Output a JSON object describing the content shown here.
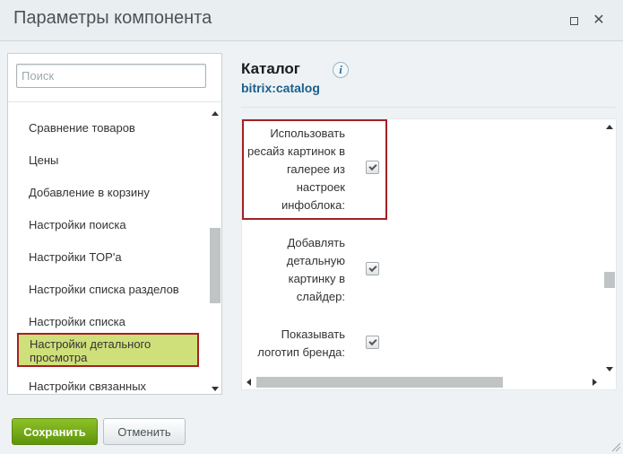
{
  "window": {
    "title": "Параметры компонента",
    "maximize_icon": "maximize-icon",
    "close_icon": "close-icon",
    "close_glyph": "✕"
  },
  "search": {
    "placeholder": "Поиск",
    "value": ""
  },
  "sidebar": {
    "items": [
      {
        "label": "Сравнение товаров",
        "active": false
      },
      {
        "label": "Цены",
        "active": false
      },
      {
        "label": "Добавление в корзину",
        "active": false
      },
      {
        "label": "Настройки поиска",
        "active": false
      },
      {
        "label": "Настройки TOP'а",
        "active": false
      },
      {
        "label": "Настройки списка разделов",
        "active": false
      },
      {
        "label": "Настройки списка",
        "active": false
      },
      {
        "label": "Настройки детального просмотра",
        "active": true
      },
      {
        "label": "Настройки связанных",
        "active": false
      }
    ]
  },
  "component": {
    "name": "Каталог",
    "code": "bitrix:catalog",
    "info_icon": "info-icon",
    "info_glyph": "i"
  },
  "params": [
    {
      "label": "Использовать ресайз картинок в галерее из настроек инфоблока:",
      "checked": true,
      "highlighted": true
    },
    {
      "label": "Добавлять детальную картинку в слайдер:",
      "checked": true,
      "highlighted": false
    },
    {
      "label": "Показывать логотип бренда:",
      "checked": true,
      "highlighted": false
    }
  ],
  "footer": {
    "save_label": "Сохранить",
    "cancel_label": "Отменить"
  },
  "colors": {
    "highlight_border": "#a32024",
    "active_item_bg": "#cfe07a",
    "save_button": "#6fa51a",
    "component_code": "#1b5f8c"
  }
}
